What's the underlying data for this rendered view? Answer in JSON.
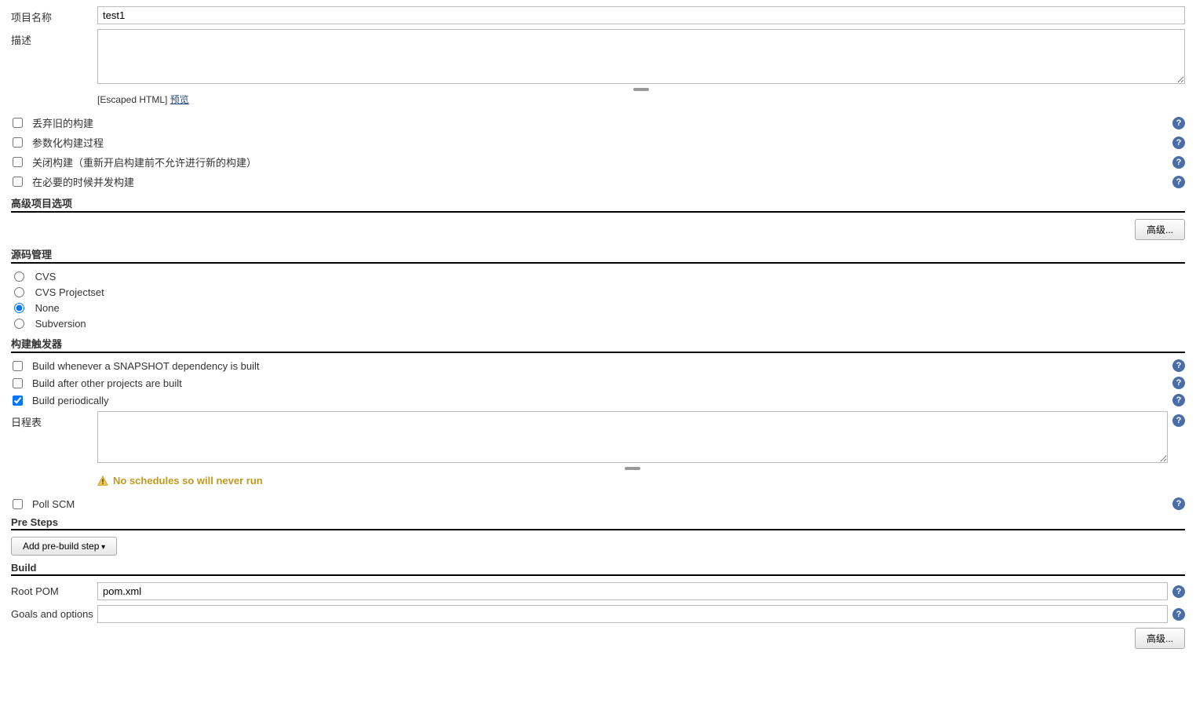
{
  "project_name": {
    "label": "项目名称",
    "value": "test1"
  },
  "description": {
    "label": "描述",
    "value": "",
    "escaped_html": "[Escaped HTML]",
    "preview": "预览"
  },
  "options": {
    "discard_old_builds": {
      "label": "丢弃旧的构建",
      "checked": false
    },
    "parameterized": {
      "label": "参数化构建过程",
      "checked": false
    },
    "disable_build": {
      "label": "关闭构建（重新开启构建前不允许进行新的构建）",
      "checked": false
    },
    "concurrent": {
      "label": "在必要的时候并发构建",
      "checked": false
    }
  },
  "advanced_options": {
    "header": "高级项目选项",
    "button": "高级..."
  },
  "scm": {
    "header": "源码管理",
    "cvs": "CVS",
    "cvs_projectset": "CVS Projectset",
    "none": "None",
    "subversion": "Subversion",
    "selected": "none"
  },
  "triggers": {
    "header": "构建触发器",
    "snapshot": {
      "label": "Build whenever a SNAPSHOT dependency is built",
      "checked": false
    },
    "after_other": {
      "label": "Build after other projects are built",
      "checked": false
    },
    "periodically": {
      "label": "Build periodically",
      "checked": true
    },
    "schedule": {
      "label": "日程表",
      "value": ""
    },
    "schedule_warning": "No schedules so will never run",
    "poll_scm": {
      "label": "Poll SCM",
      "checked": false
    }
  },
  "pre_steps": {
    "header": "Pre Steps",
    "button": "Add pre-build step"
  },
  "build": {
    "header": "Build",
    "root_pom": {
      "label": "Root POM",
      "value": "pom.xml"
    },
    "goals": {
      "label": "Goals and options",
      "value": ""
    },
    "advanced_button": "高级..."
  },
  "help_glyph": "?"
}
